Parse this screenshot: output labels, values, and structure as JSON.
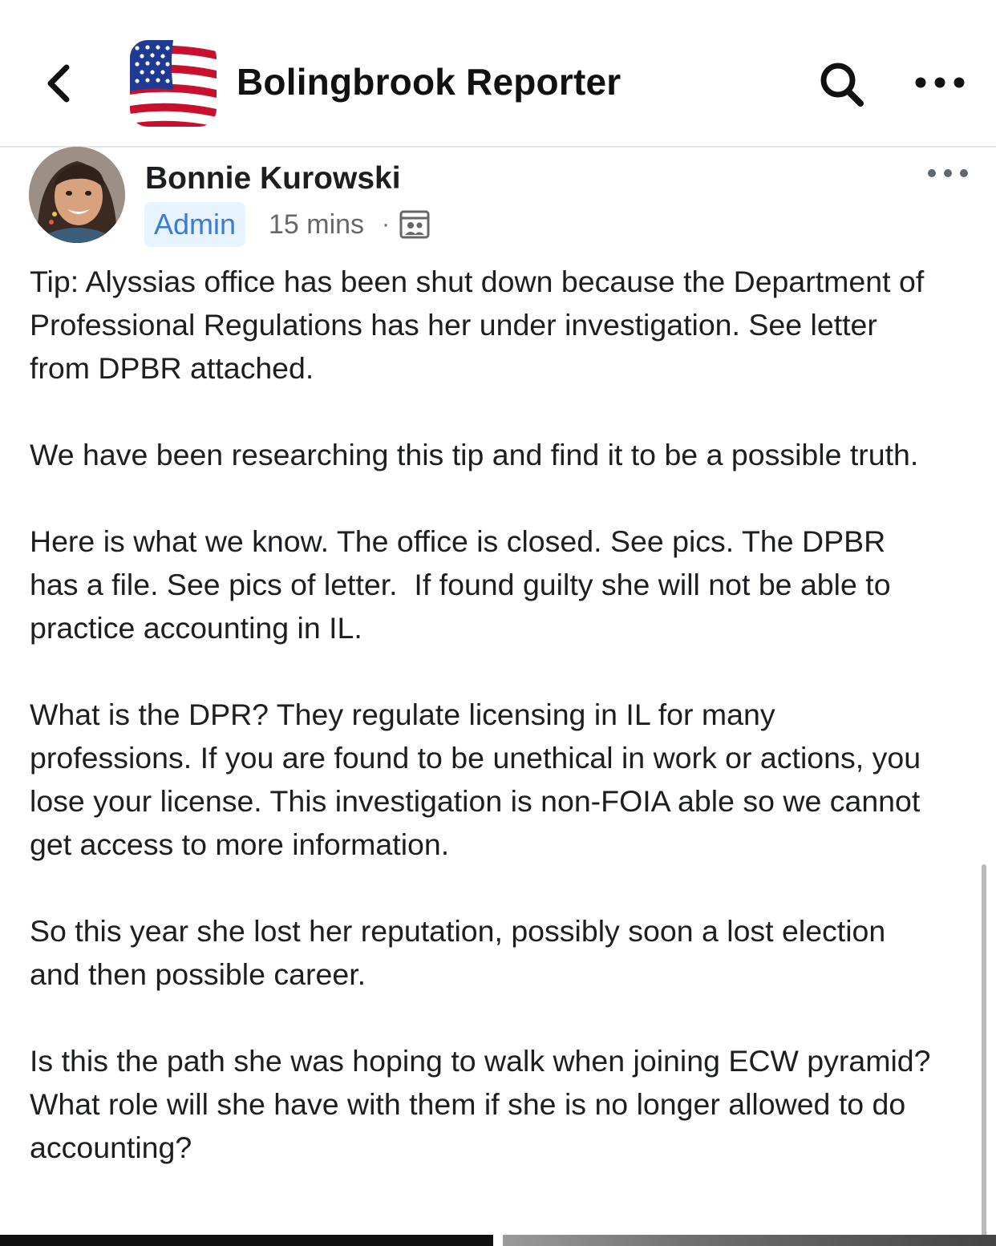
{
  "header": {
    "back_icon": "chevron-left-icon",
    "group_avatar_icon": "american-flag-icon",
    "title": "Bolingbrook Reporter",
    "search_icon": "search-icon",
    "more_icon": "more-horizontal-icon"
  },
  "post": {
    "author": "Bonnie Kurowski",
    "badge": "Admin",
    "time": "15 mins",
    "separator": "·",
    "privacy_icon": "group-members-icon",
    "more_icon": "more-horizontal-icon",
    "paragraphs": [
      "Tip: Alyssias office has been shut down because the Department of Professional Regulations has her under investigation. See letter from DPBR attached.",
      "We have been researching this tip and find it to be a possible truth.",
      "Here is what we know. The office is closed. See pics. The DPBR has a file. See pics of letter.  If found guilty she will not be able to practice accounting in IL.",
      "What is the DPR? They regulate licensing in IL for many professions. If you are found to be unethical in work or actions, you lose your license. This investigation is non-FOIA able so we cannot get access to more information.",
      "So this year she lost her reputation, possibly soon a lost election and then possible career.",
      "Is this the path she was hoping to walk when joining ECW pyramid? What role will she have with them if she is no longer allowed to do accounting?"
    ]
  },
  "colors": {
    "text": "#1c1e21",
    "muted": "#65676b",
    "badge_bg": "#e7f3ff",
    "badge_text": "#3a7bd5",
    "divider": "#e4e6eb"
  }
}
